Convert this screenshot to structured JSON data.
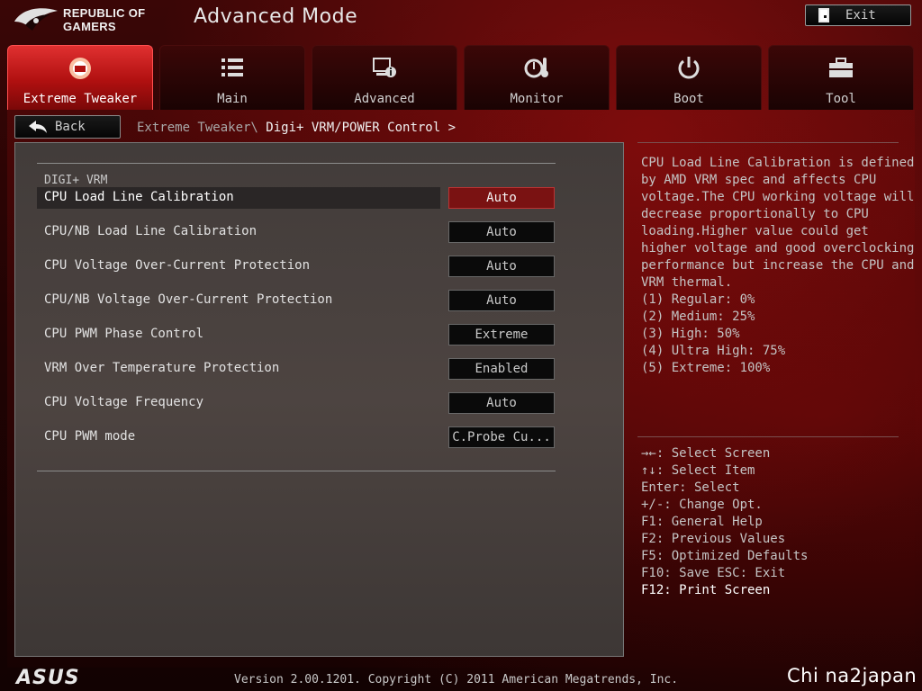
{
  "header": {
    "brand_line1": "REPUBLIC OF",
    "brand_line2": "GAMERS",
    "mode_title": "Advanced Mode",
    "exit_label": "Exit"
  },
  "tabs": [
    {
      "label": "Extreme Tweaker",
      "icon": "tweaker-icon",
      "active": true
    },
    {
      "label": "Main",
      "icon": "list-icon",
      "active": false
    },
    {
      "label": "Advanced",
      "icon": "advanced-info-icon",
      "active": false
    },
    {
      "label": "Monitor",
      "icon": "monitor-gauge-icon",
      "active": false
    },
    {
      "label": "Boot",
      "icon": "power-icon",
      "active": false
    },
    {
      "label": "Tool",
      "icon": "toolbox-icon",
      "active": false
    }
  ],
  "nav": {
    "back_label": "Back",
    "breadcrumb_parent": "Extreme Tweaker\\",
    "breadcrumb_current": "Digi+ VRM/POWER Control >"
  },
  "settings": {
    "section_title": "DIGI+ VRM",
    "items": [
      {
        "name": "CPU Load Line Calibration",
        "value": "Auto",
        "selected": true
      },
      {
        "name": "CPU/NB Load Line Calibration",
        "value": "Auto"
      },
      {
        "name": "CPU Voltage Over-Current Protection",
        "value": "Auto"
      },
      {
        "name": "CPU/NB Voltage Over-Current Protection",
        "value": "Auto"
      },
      {
        "name": "CPU PWM Phase Control",
        "value": "Extreme"
      },
      {
        "name": "VRM Over Temperature Protection",
        "value": "Enabled"
      },
      {
        "name": "CPU Voltage Frequency",
        "value": "Auto"
      },
      {
        "name": "CPU PWM mode",
        "value": "C.Probe Cu..."
      }
    ]
  },
  "help": {
    "lines": [
      "CPU Load Line Calibration is defined",
      "by AMD VRM spec and affects CPU",
      "voltage.The CPU working voltage will",
      "decrease proportionally to CPU",
      "loading.Higher value could get",
      "higher voltage and good overclocking",
      "performance but increase the CPU and",
      "VRM thermal.",
      "(1) Regular: 0%",
      "(2) Medium: 25%",
      "(3) High: 50%",
      "(4) Ultra High: 75%",
      "(5) Extreme: 100%"
    ]
  },
  "keys": [
    "→←: Select Screen",
    "↑↓: Select Item",
    "Enter: Select",
    "+/-: Change Opt.",
    "F1: General Help",
    "F2: Previous Values",
    "F5: Optimized Defaults",
    "F10: Save  ESC: Exit",
    "F12: Print Screen"
  ],
  "footer": {
    "brand": "ASUS",
    "version": "Version 2.00.1201. Copyright (C) 2011 American Megatrends, Inc.",
    "watermark": "Chi na2japan"
  },
  "colors": {
    "accent_red": "#d01818",
    "selected_value_bg": "#7a1212",
    "panel_gray": "#4a4240"
  }
}
